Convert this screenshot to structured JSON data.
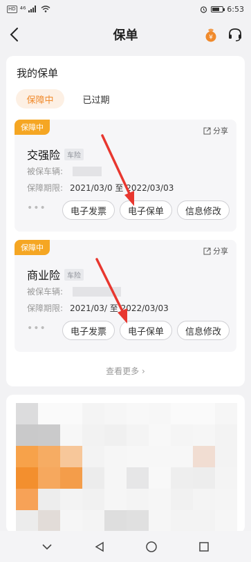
{
  "status_bar": {
    "hd": "HD",
    "signal": "⁴⁶",
    "time": "6:53",
    "battery_level": 0.72
  },
  "nav": {
    "title": "保单"
  },
  "section": {
    "title": "我的保单"
  },
  "tabs": [
    {
      "label": "保障中",
      "active": true
    },
    {
      "label": "已过期",
      "active": false
    }
  ],
  "policies": [
    {
      "status": "保障中",
      "share": "分享",
      "name": "交强险",
      "type": "车险",
      "vehicle_label": "被保车辆:",
      "period_label": "保障期限:",
      "period_value": "2021/03/0 至 2022/03/03",
      "buttons": [
        "电子发票",
        "电子保单",
        "信息修改"
      ],
      "more": "•••"
    },
    {
      "status": "保障中",
      "share": "分享",
      "name": "商业险",
      "type": "车险",
      "vehicle_label": "被保车辆:",
      "period_label": "保障期限:",
      "period_value": "2021/03/ 至 2022/03/03",
      "buttons": [
        "电子发票",
        "电子保单",
        "信息修改"
      ],
      "more": "•••"
    }
  ],
  "see_more": "查看更多",
  "colors": {
    "accent": "#f08a2c",
    "ribbon": "#f5a623",
    "arrow": "#e8372f"
  }
}
